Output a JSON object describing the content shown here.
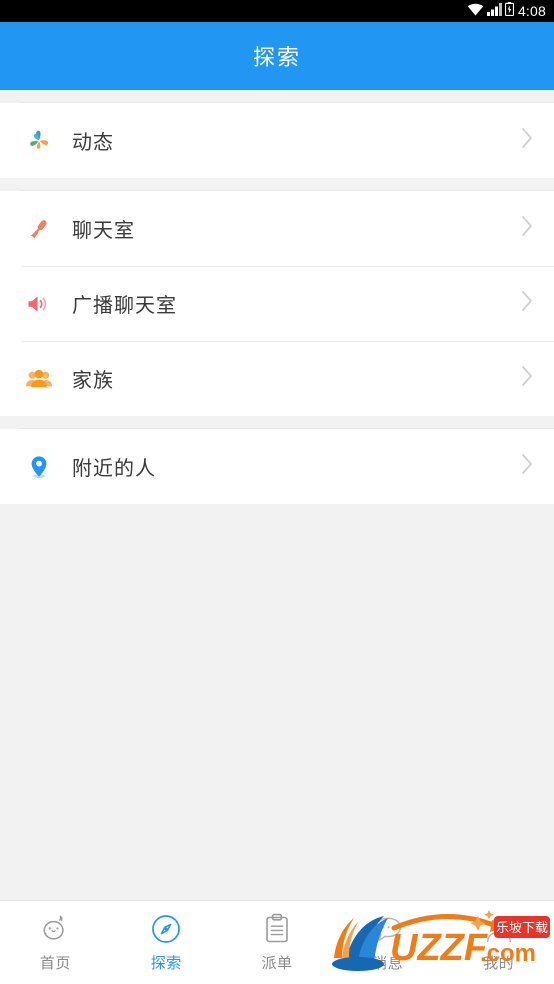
{
  "statusbar": {
    "time": "4:08",
    "icons": [
      "wifi-icon",
      "signal-icon",
      "battery-charging-icon"
    ]
  },
  "header": {
    "title": "探索",
    "background_color": "#2196f3",
    "text_color": "#ffffff"
  },
  "list": {
    "groups": [
      {
        "rows": [
          {
            "label": "动态",
            "icon": "pinwheel-icon",
            "icon_color": "#4a90e2",
            "accessory": "chevron-right-icon"
          }
        ]
      },
      {
        "rows": [
          {
            "label": "聊天室",
            "icon": "microphone-icon",
            "icon_color": "#f08060",
            "accessory": "chevron-right-icon"
          },
          {
            "label": "广播聊天室",
            "icon": "speaker-icon",
            "icon_color": "#f4666e",
            "accessory": "chevron-right-icon"
          },
          {
            "label": "家族",
            "icon": "group-people-icon",
            "icon_color": "#f5a142",
            "accessory": "chevron-right-icon"
          }
        ]
      },
      {
        "rows": [
          {
            "label": "附近的人",
            "icon": "location-pin-icon",
            "icon_color": "#2196f3",
            "accessory": "chevron-right-icon"
          }
        ]
      }
    ]
  },
  "bottom_nav": {
    "active_color": "#2196f3",
    "inactive_color": "#8a8a8a",
    "items": [
      {
        "label": "首页",
        "icon": "face-home-icon",
        "active": false
      },
      {
        "label": "探索",
        "icon": "compass-icon",
        "active": true
      },
      {
        "label": "派单",
        "icon": "clipboard-icon",
        "active": false
      },
      {
        "label": "消息",
        "icon": "chat-bubble-icon",
        "active": false
      },
      {
        "label": "我的",
        "icon": "person-icon",
        "active": false
      }
    ]
  },
  "watermark": {
    "brand": "UZZF",
    "domain": ".com",
    "badge": "乐坡下载",
    "brand_color": "#f07c18",
    "logo_color": "#1668b3",
    "badge_color": "#e8342a"
  }
}
